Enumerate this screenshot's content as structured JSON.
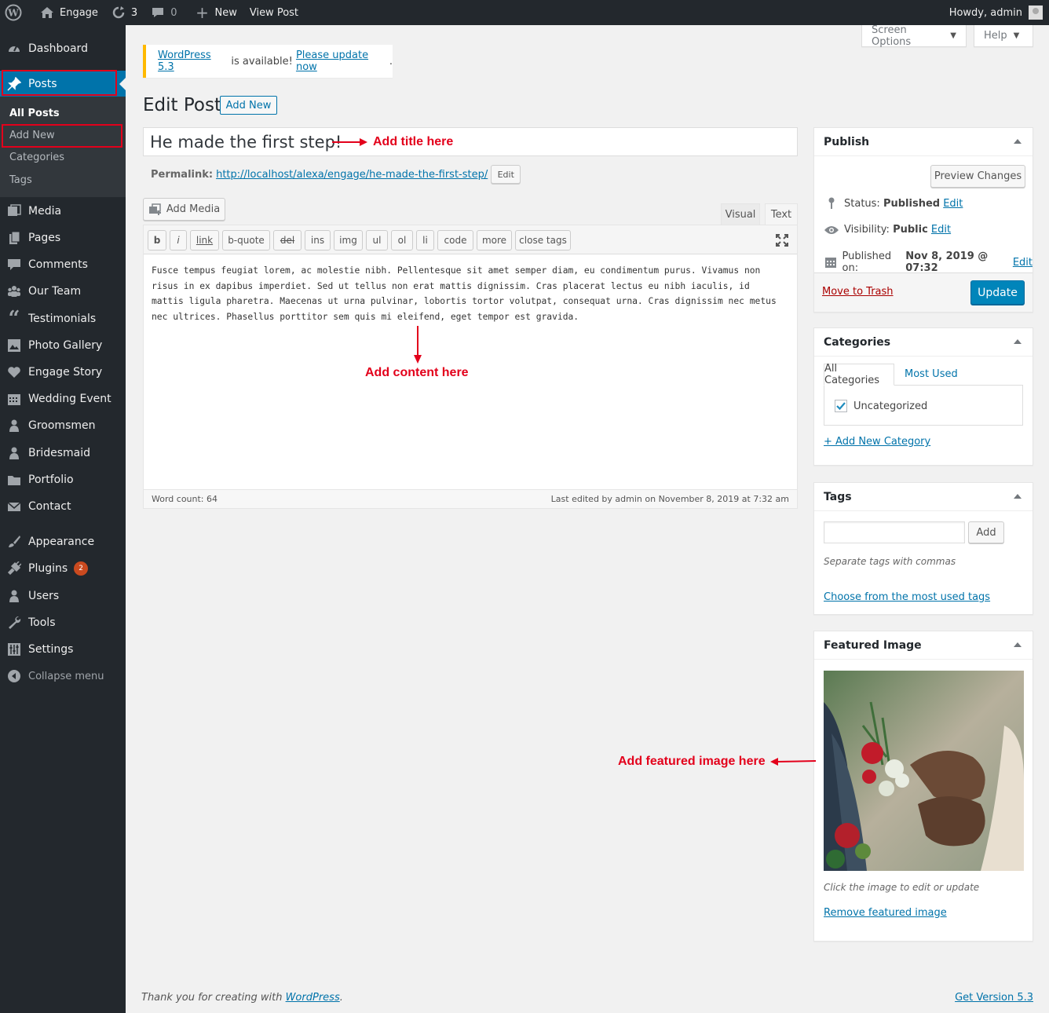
{
  "adminbar": {
    "site_name": "Engage",
    "updates_count": "3",
    "comments_count": "0",
    "new_label": "New",
    "view_post_label": "View Post",
    "howdy": "Howdy, admin"
  },
  "sidebar": {
    "items": [
      {
        "label": "Dashboard",
        "icon": "dashboard-icon"
      },
      {
        "label": "Posts",
        "icon": "pin-icon"
      },
      {
        "label": "Media",
        "icon": "media-icon"
      },
      {
        "label": "Pages",
        "icon": "pages-icon"
      },
      {
        "label": "Comments",
        "icon": "comments-icon"
      },
      {
        "label": "Our Team",
        "icon": "groups-icon"
      },
      {
        "label": "Testimonials",
        "icon": "quote-icon"
      },
      {
        "label": "Photo Gallery",
        "icon": "gallery-icon"
      },
      {
        "label": "Engage Story",
        "icon": "heart-icon"
      },
      {
        "label": "Wedding Event",
        "icon": "calendar-icon"
      },
      {
        "label": "Groomsmen",
        "icon": "person-icon"
      },
      {
        "label": "Bridesmaid",
        "icon": "person-icon"
      },
      {
        "label": "Portfolio",
        "icon": "folder-icon"
      },
      {
        "label": "Contact",
        "icon": "email-icon"
      },
      {
        "label": "Appearance",
        "icon": "brush-icon"
      },
      {
        "label": "Plugins",
        "icon": "plugin-icon",
        "badge": "2"
      },
      {
        "label": "Users",
        "icon": "users-icon"
      },
      {
        "label": "Tools",
        "icon": "wrench-icon"
      },
      {
        "label": "Settings",
        "icon": "settings-icon"
      },
      {
        "label": "Collapse menu",
        "icon": "collapse-icon"
      }
    ],
    "submenu": [
      "All Posts",
      "Add New",
      "Categories",
      "Tags"
    ]
  },
  "top_buttons": {
    "screen_options": "Screen Options",
    "help": "Help"
  },
  "notice": {
    "version_link": "WordPress 5.3",
    "middle": " is available! ",
    "update_link": "Please update now",
    "end": "."
  },
  "page": {
    "title": "Edit Post",
    "add_new": "Add New"
  },
  "post": {
    "title": "He made the first step!",
    "permalink_label": "Permalink:",
    "permalink_url": "http://localhost/alexa/engage/he-made-the-first-step/",
    "permalink_edit": "Edit",
    "content": "Fusce tempus feugiat lorem, ac molestie nibh. Pellentesque sit amet semper diam, eu condimentum purus. Vivamus non risus in ex dapibus imperdiet. Sed ut tellus non erat mattis dignissim. Cras placerat lectus eu nibh iaculis, id mattis ligula pharetra. Maecenas ut urna pulvinar, lobortis tortor volutpat, consequat urna. Cras dignissim nec metus nec ultrices. Phasellus porttitor sem quis mi eleifend, eget tempor est gravida.",
    "word_count": "Word count: 64",
    "last_edited": "Last edited by admin on November 8, 2019 at 7:32 am"
  },
  "editor": {
    "add_media": "Add Media",
    "tab_visual": "Visual",
    "tab_text": "Text",
    "quicktags": [
      "b",
      "i",
      "link",
      "b-quote",
      "del",
      "ins",
      "img",
      "ul",
      "ol",
      "li",
      "code",
      "more",
      "close tags"
    ]
  },
  "annotations": {
    "title": "Add title here",
    "content": "Add content here",
    "featured": "Add featured image here"
  },
  "publish": {
    "heading": "Publish",
    "preview": "Preview Changes",
    "status_label": "Status:",
    "status_value": "Published",
    "visibility_label": "Visibility:",
    "visibility_value": "Public",
    "published_label": "Published on:",
    "published_value": "Nov 8, 2019 @ 07:32",
    "edit": "Edit",
    "trash": "Move to Trash",
    "update": "Update"
  },
  "categories": {
    "heading": "Categories",
    "tab_all": "All Categories",
    "tab_most": "Most Used",
    "items": [
      {
        "label": "Uncategorized",
        "checked": true
      }
    ],
    "add_new": "+ Add New Category"
  },
  "tags": {
    "heading": "Tags",
    "input_value": "",
    "add": "Add",
    "hint": "Separate tags with commas",
    "choose": "Choose from the most used tags"
  },
  "featured_image": {
    "heading": "Featured Image",
    "hint": "Click the image to edit or update",
    "remove": "Remove featured image"
  },
  "footer": {
    "thanks_prefix": "Thank you for creating with ",
    "wordpress": "WordPress",
    "thanks_suffix": ".",
    "version": "Get Version 5.3"
  },
  "colors": {
    "accent": "#0073aa",
    "annotation": "#e3001b",
    "sidebar": "#23282d",
    "notice": "#ffb900"
  }
}
